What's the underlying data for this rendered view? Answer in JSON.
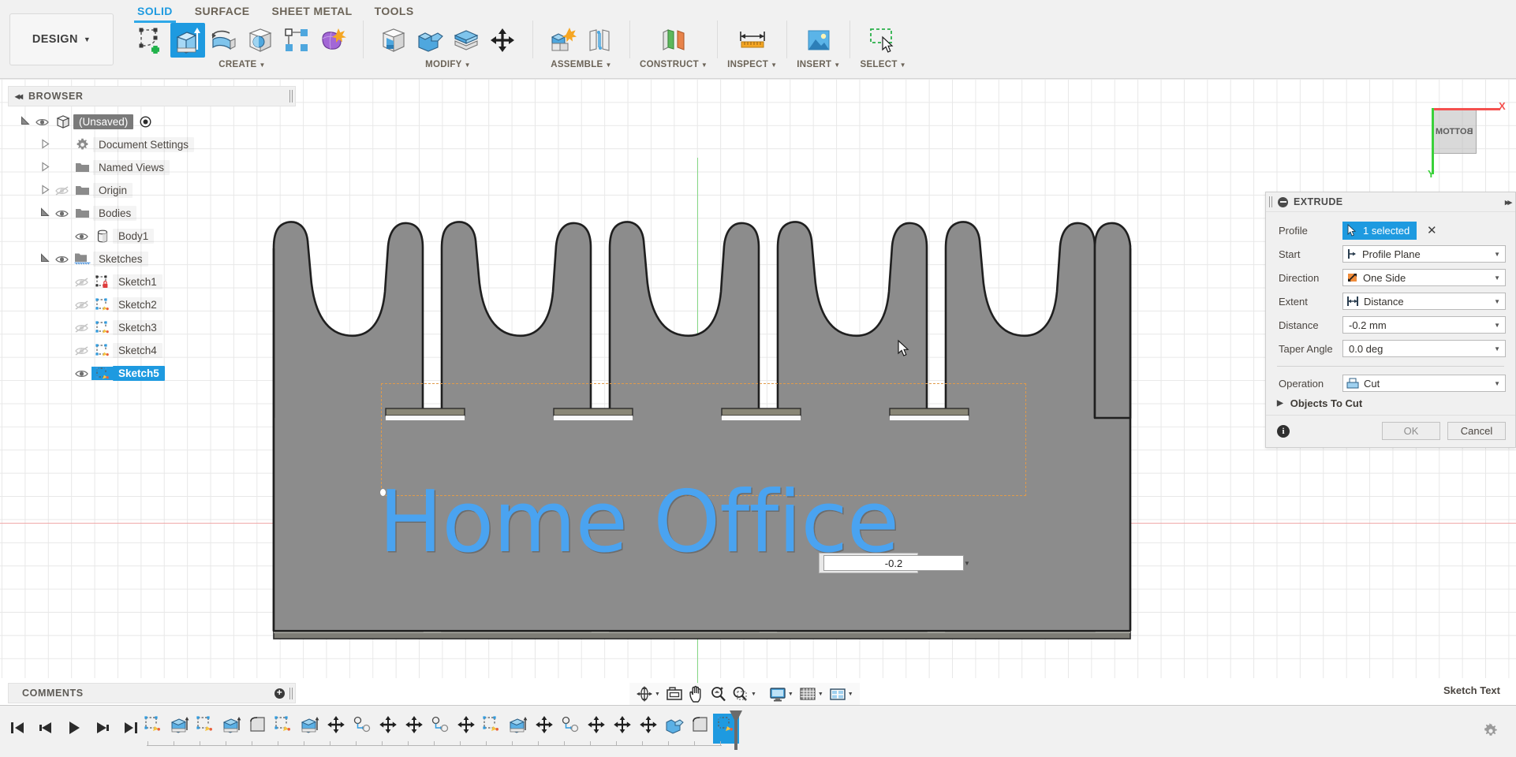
{
  "app": {
    "workspace_button": "DESIGN",
    "tabs": [
      {
        "label": "SOLID",
        "active": true
      },
      {
        "label": "SURFACE",
        "active": false
      },
      {
        "label": "SHEET METAL",
        "active": false
      },
      {
        "label": "TOOLS",
        "active": false
      }
    ],
    "ribbon_groups": [
      {
        "label": "CREATE",
        "icons": [
          "create-sketch-icon",
          "extrude-icon",
          "revolve-icon",
          "sphere-icon",
          "pattern-icon",
          "form-icon"
        ]
      },
      {
        "label": "MODIFY",
        "icons": [
          "press-pull-icon",
          "combine-icon",
          "shell-icon",
          "move-copy-icon"
        ]
      },
      {
        "label": "ASSEMBLE",
        "icons": [
          "new-component-icon",
          "joint-icon"
        ]
      },
      {
        "label": "CONSTRUCT",
        "icons": [
          "offset-plane-icon"
        ]
      },
      {
        "label": "INSPECT",
        "icons": [
          "measure-icon"
        ]
      },
      {
        "label": "INSERT",
        "icons": [
          "insert-image-icon"
        ]
      },
      {
        "label": "SELECT",
        "icons": [
          "window-select-icon"
        ]
      }
    ]
  },
  "browser": {
    "title": "BROWSER",
    "items": [
      {
        "label": "(Unsaved)",
        "indent": 0,
        "expander": "expanded",
        "eye": "visible",
        "icon": "component-icon",
        "state": "selected-dark",
        "trailing": "radio-icon"
      },
      {
        "label": "Document Settings",
        "indent": 1,
        "expander": "collapsed",
        "eye": "none",
        "icon": "gear-icon",
        "state": "normal",
        "trailing": ""
      },
      {
        "label": "Named Views",
        "indent": 1,
        "expander": "collapsed",
        "eye": "none",
        "icon": "folder-icon",
        "state": "normal",
        "trailing": ""
      },
      {
        "label": "Origin",
        "indent": 1,
        "expander": "collapsed",
        "eye": "hidden",
        "icon": "folder-icon",
        "state": "normal",
        "trailing": ""
      },
      {
        "label": "Bodies",
        "indent": 1,
        "expander": "expanded",
        "eye": "visible",
        "icon": "folder-icon",
        "state": "normal",
        "trailing": ""
      },
      {
        "label": "Body1",
        "indent": 2,
        "expander": "none",
        "eye": "visible",
        "icon": "body-icon",
        "state": "normal",
        "trailing": ""
      },
      {
        "label": "Sketches",
        "indent": 1,
        "expander": "expanded",
        "eye": "visible",
        "icon": "sketches-folder-icon",
        "state": "normal",
        "trailing": ""
      },
      {
        "label": "Sketch1",
        "indent": 2,
        "expander": "none",
        "eye": "hidden",
        "icon": "sketch-locked-icon",
        "state": "normal",
        "trailing": ""
      },
      {
        "label": "Sketch2",
        "indent": 2,
        "expander": "none",
        "eye": "hidden",
        "icon": "sketch-icon",
        "state": "normal",
        "trailing": ""
      },
      {
        "label": "Sketch3",
        "indent": 2,
        "expander": "none",
        "eye": "hidden",
        "icon": "sketch-icon",
        "state": "normal",
        "trailing": ""
      },
      {
        "label": "Sketch4",
        "indent": 2,
        "expander": "none",
        "eye": "hidden",
        "icon": "sketch-icon",
        "state": "normal",
        "trailing": ""
      },
      {
        "label": "Sketch5",
        "indent": 2,
        "expander": "none",
        "eye": "visible",
        "icon": "sketch-icon",
        "state": "selected-blue",
        "trailing": ""
      }
    ]
  },
  "extrude_dialog": {
    "title": "EXTRUDE",
    "profile": {
      "label": "Profile",
      "value": "1 selected",
      "clear": "✕"
    },
    "start": {
      "label": "Start",
      "value": "Profile Plane",
      "icon": "start-plane-icon"
    },
    "direction": {
      "label": "Direction",
      "value": "One Side",
      "icon": "direction-one-side-icon"
    },
    "extent": {
      "label": "Extent",
      "value": "Distance",
      "icon": "extent-distance-icon"
    },
    "distance": {
      "label": "Distance",
      "value": "-0.2 mm"
    },
    "taper_angle": {
      "label": "Taper Angle",
      "value": "0.0 deg"
    },
    "operation": {
      "label": "Operation",
      "value": "Cut",
      "icon": "cut-operation-icon"
    },
    "objects_to_cut": "Objects To Cut",
    "ok": "OK",
    "cancel": "Cancel",
    "accent_color": "#1e9ae0"
  },
  "canvas": {
    "sketch_text": "Home Office",
    "sketch_text_color": "#4aa3f0",
    "inline_dimension_value": "-0.2",
    "body_color": "#8c8c8c",
    "selection_box_color": "#e09a4a",
    "viewcube": {
      "face": "BOTTOM",
      "x_axis": "X",
      "y_axis": "Y"
    }
  },
  "footer": {
    "comments_label": "COMMENTS",
    "status_right": "Sketch Text",
    "nav_icons": [
      "orbit-icon",
      "look-at-icon",
      "pan-icon",
      "zoom-icon",
      "zoom-window-icon",
      "display-settings-icon",
      "grid-snaps-icon",
      "viewports-icon"
    ],
    "playback_icons": [
      "go-to-start-icon",
      "step-back-icon",
      "play-icon",
      "step-forward-icon",
      "go-to-end-icon"
    ],
    "timeline_features": [
      "sketch-feature",
      "extrude-feature",
      "sketch-feature",
      "extrude-feature",
      "fillet-feature",
      "sketch-feature",
      "extrude-feature",
      "move-feature",
      "align-feature",
      "move-feature",
      "move-feature",
      "align-feature",
      "move-feature",
      "sketch-feature",
      "extrude-feature",
      "move-feature",
      "align-feature",
      "move-feature",
      "move-feature",
      "move-feature",
      "combine-feature",
      "fillet-feature",
      "sketch-feature"
    ],
    "settings_icon": "gear-icon"
  }
}
